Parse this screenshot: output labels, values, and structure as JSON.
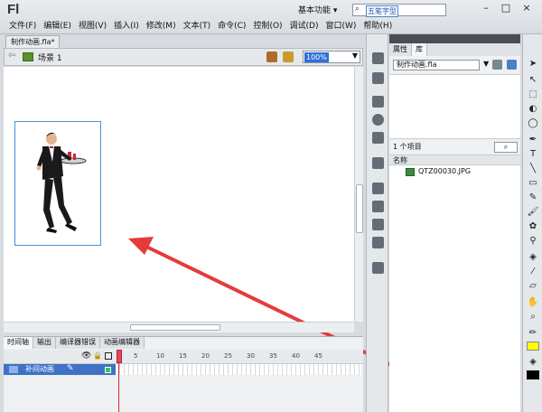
{
  "app": {
    "logo": "Fl"
  },
  "menu": [
    "文件(F)",
    "编辑(E)",
    "视图(V)",
    "插入(I)",
    "修改(M)",
    "文本(T)",
    "命令(C)",
    "控制(O)",
    "调试(D)",
    "窗口(W)",
    "帮助(H)"
  ],
  "header": {
    "workspace": "基本功能 ▾",
    "search_text": "五笔字型",
    "min": "–",
    "max": "□",
    "close": "×"
  },
  "document": {
    "tab": "制作动画.fla*"
  },
  "scene": {
    "label": "场景 1",
    "zoom": "100%"
  },
  "timeline": {
    "tabs": [
      "时间轴",
      "输出",
      "编译器错误",
      "动画编辑器"
    ],
    "layer_name": "补间动画",
    "frame_numbers": [
      "5",
      "10",
      "15",
      "20",
      "25",
      "30",
      "35",
      "40",
      "45"
    ]
  },
  "library": {
    "tabs": [
      "属性",
      "库"
    ],
    "doc": "制作动画.fla",
    "count": "1 个项目",
    "column_name": "名称",
    "items": [
      {
        "name": "QTZ00030.JPG"
      }
    ]
  },
  "colors": {
    "accent": "#2f6fd6",
    "layer": "#3f72c7",
    "arrow": "#e53b3b",
    "stroke_swatch": "#ffff00",
    "fill_swatch": "#000000"
  }
}
